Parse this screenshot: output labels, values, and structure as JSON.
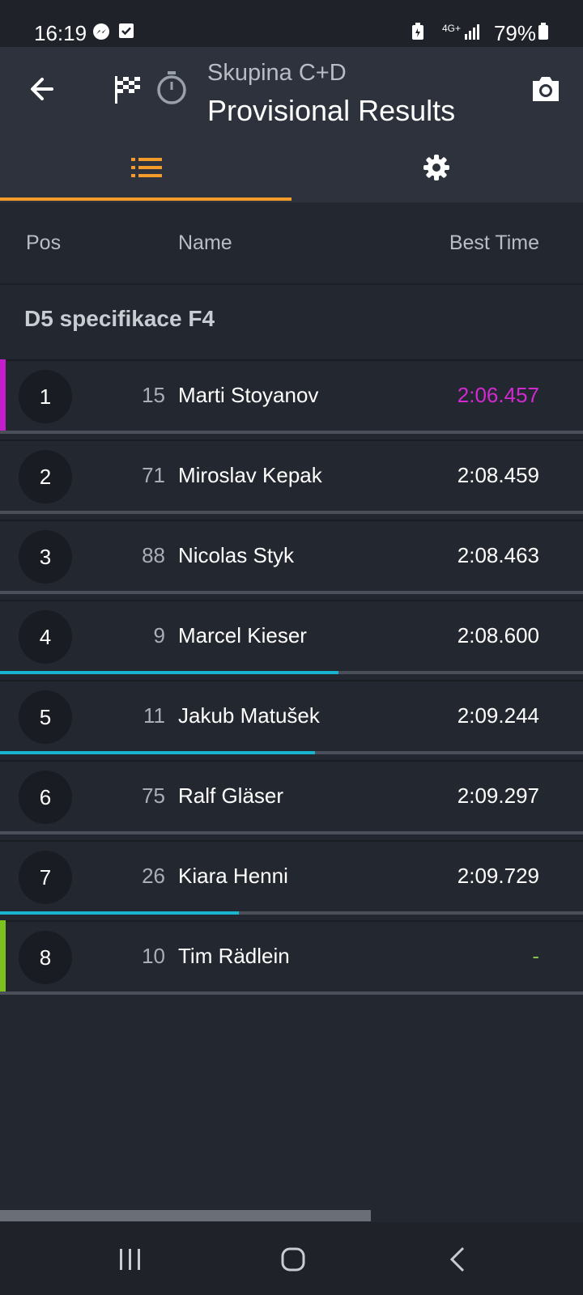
{
  "status_bar": {
    "time": "16:19",
    "network": "4G+",
    "battery": "79%"
  },
  "app_bar": {
    "subtitle": "Skupina C+D",
    "title": "Provisional Results",
    "icons": [
      "back-arrow",
      "checkered-flag",
      "stopwatch",
      "camera"
    ]
  },
  "tabs": [
    {
      "icon": "list",
      "active": true
    },
    {
      "icon": "gear",
      "active": false
    }
  ],
  "table_header": {
    "pos": "Pos",
    "name": "Name",
    "best_time": "Best Time"
  },
  "section": {
    "title": "D5 specifikace F4"
  },
  "rows": [
    {
      "pos": "1",
      "number": "15",
      "name": "Marti Stoyanov",
      "best_time": "2:06.457",
      "time_color": "#d12ad2",
      "accent": "#c21ecb",
      "progress": null
    },
    {
      "pos": "2",
      "number": "71",
      "name": "Miroslav Kepak",
      "best_time": "2:08.459",
      "time_color": "#ffffff",
      "accent": null,
      "progress": null
    },
    {
      "pos": "3",
      "number": "88",
      "name": "Nicolas Styk",
      "best_time": "2:08.463",
      "time_color": "#ffffff",
      "accent": null,
      "progress": null
    },
    {
      "pos": "4",
      "number": "9",
      "name": "Marcel Kieser",
      "best_time": "2:08.600",
      "time_color": "#ffffff",
      "accent": null,
      "progress": 0.58
    },
    {
      "pos": "5",
      "number": "11",
      "name": "Jakub Matušek",
      "best_time": "2:09.244",
      "time_color": "#ffffff",
      "accent": null,
      "progress": 0.54
    },
    {
      "pos": "6",
      "number": "75",
      "name": "Ralf Gläser",
      "best_time": "2:09.297",
      "time_color": "#ffffff",
      "accent": null,
      "progress": null
    },
    {
      "pos": "7",
      "number": "26",
      "name": "Kiara Henni",
      "best_time": "2:09.729",
      "time_color": "#ffffff",
      "accent": null,
      "progress": 0.41
    },
    {
      "pos": "8",
      "number": "10",
      "name": "Tim Rädlein",
      "best_time": "-",
      "time_color": "#8bc34a",
      "accent": "#7cc21e",
      "progress": null
    }
  ],
  "colors": {
    "tab_indicator": "#f39c2c",
    "progress": "#19b5cf",
    "background": "#23272f"
  }
}
